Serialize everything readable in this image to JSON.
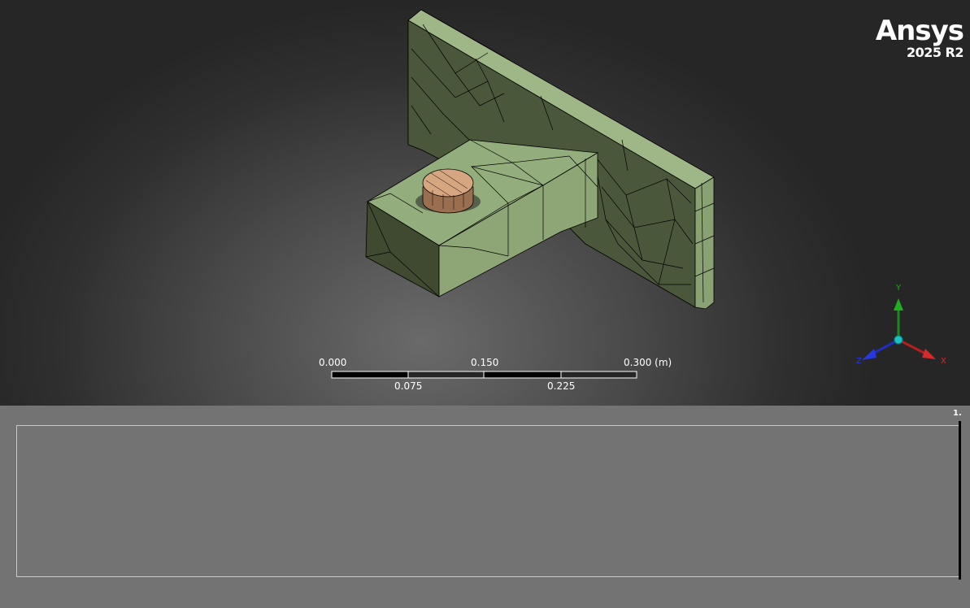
{
  "logo": {
    "brand": "Ansys",
    "version": "2025 R2"
  },
  "scale_bar": {
    "top_labels": [
      "0.000",
      "0.150",
      "0.300 (m)"
    ],
    "bottom_labels": [
      "0.075",
      "0.225"
    ]
  },
  "triad": {
    "x": "X",
    "y": "Y",
    "z": "Z"
  },
  "graph": {
    "label": "1."
  },
  "colors": {
    "mesh_body": "#9db585",
    "mesh_body_dark": "#55633f",
    "cylinder": "#d4a37f",
    "edges": "#000000"
  }
}
